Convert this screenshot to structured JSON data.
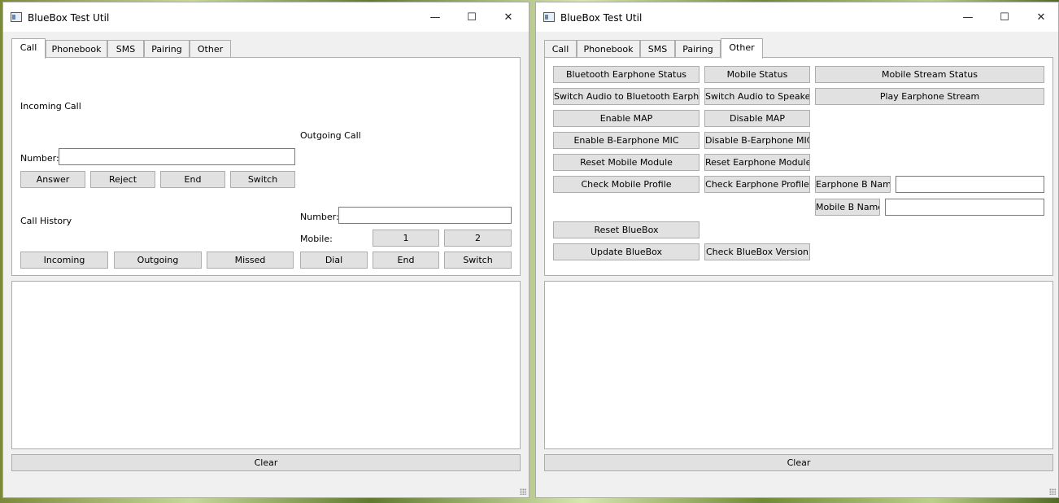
{
  "windows": [
    {
      "title": "BlueBox Test Util",
      "tabs": [
        "Call",
        "Phonebook",
        "SMS",
        "Pairing",
        "Other"
      ],
      "active_tab": "Call",
      "call": {
        "incoming_label": "Incoming Call",
        "number_label": "Number:",
        "number_value": "",
        "answer": "Answer",
        "reject": "Reject",
        "end": "End",
        "switch": "Switch",
        "history_label": "Call History",
        "incoming": "Incoming",
        "outgoing": "Outgoing",
        "missed": "Missed",
        "outgoing_label": "Outgoing Call",
        "out_number_label": "Number:",
        "out_number_value": "",
        "mobile_label": "Mobile:",
        "mobile_1": "1",
        "mobile_2": "2",
        "dial": "Dial",
        "out_end": "End",
        "out_switch": "Switch"
      },
      "clear": "Clear"
    },
    {
      "title": "BlueBox Test Util",
      "tabs": [
        "Call",
        "Phonebook",
        "SMS",
        "Pairing",
        "Other"
      ],
      "active_tab": "Other",
      "other": {
        "bt_earphone_status": "Bluetooth Earphone Status",
        "mobile_status": "Mobile Status",
        "mobile_stream_status": "Mobile Stream Status",
        "switch_to_bt": "Switch Audio to Bluetooth Earphone",
        "switch_to_speaker": "Switch  Audio to Speaker",
        "play_earphone_stream": "Play Earphone Stream",
        "enable_map": "Enable MAP",
        "disable_map": "Disable MAP",
        "enable_mic": "Enable B-Earphone MIC",
        "disable_mic": "Disable B-Earphone MIC",
        "reset_mobile": "Reset Mobile Module",
        "reset_earphone": "Reset Earphone Module",
        "check_mobile_profile": "Check Mobile Profile",
        "check_earphone_profile": "Check Earphone Profile",
        "earphone_name_label": "Earphone B Name",
        "earphone_name_value": "",
        "mobile_name_label": "Mobile B Name",
        "mobile_name_value": "",
        "reset_bluebox": "Reset BlueBox",
        "update_bluebox": "Update BlueBox",
        "check_version": "Check BlueBox Version"
      },
      "clear": "Clear"
    }
  ],
  "window_controls": {
    "minimize": "—",
    "maximize": "☐",
    "close": "✕"
  }
}
